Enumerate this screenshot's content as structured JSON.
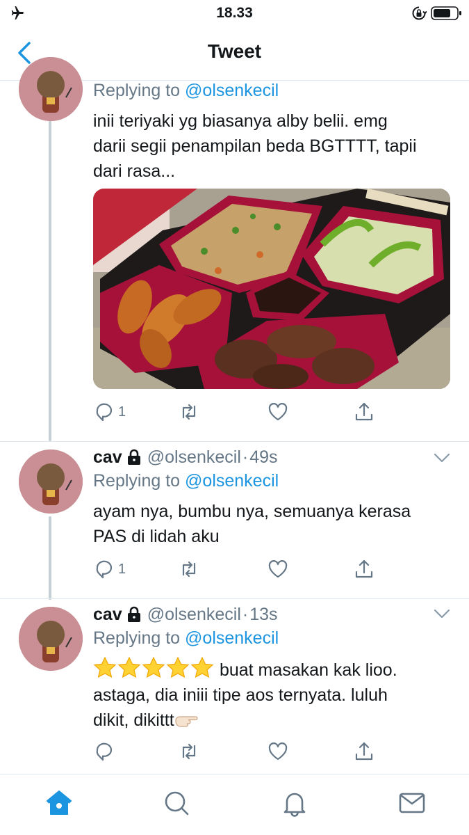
{
  "status_bar": {
    "time": "18.33",
    "airplane_icon": "airplane-icon",
    "rotation_lock_icon": "rotation-lock-icon",
    "battery_icon": "battery-icon"
  },
  "nav": {
    "title": "Tweet",
    "back_icon": "chevron-left-icon"
  },
  "colors": {
    "accent": "#1b95e0",
    "text": "#14171a",
    "muted": "#657786",
    "divider": "#e1e8ed",
    "thread_line": "#c4cfd6"
  },
  "tweets": [
    {
      "reply_prefix": "Replying to",
      "reply_to": "@olsenkecil",
      "text_lines": [
        "inii teriyaki yg biasanya alby belii. emg",
        "darii segii penampilan beda BGTTTT, tapii",
        "dari rasa..."
      ],
      "reply_count": "1"
    },
    {
      "name": "cav",
      "handle": "@olsenkecil",
      "dot": "·",
      "time": "49s",
      "reply_prefix": "Replying to",
      "reply_to": "@olsenkecil",
      "text_lines": [
        "ayam nya, bumbu nya, semuanya kerasa",
        "PAS di lidah aku"
      ],
      "reply_count": "1"
    },
    {
      "name": "cav",
      "handle": "@olsenkecil",
      "dot": "·",
      "time": "13s",
      "reply_prefix": "Replying to",
      "reply_to": "@olsenkecil",
      "text_line1_after_stars": " buat masakan kak lioo.",
      "text_lines_rest": [
        "astaga, dia iniii tipe aos ternyata. luluh"
      ],
      "text_line_last": "dikit, dikittt",
      "rating_stars": 5
    }
  ],
  "tab_bar": {
    "icons": [
      "home-icon",
      "search-icon",
      "bell-icon",
      "mail-icon"
    ]
  }
}
